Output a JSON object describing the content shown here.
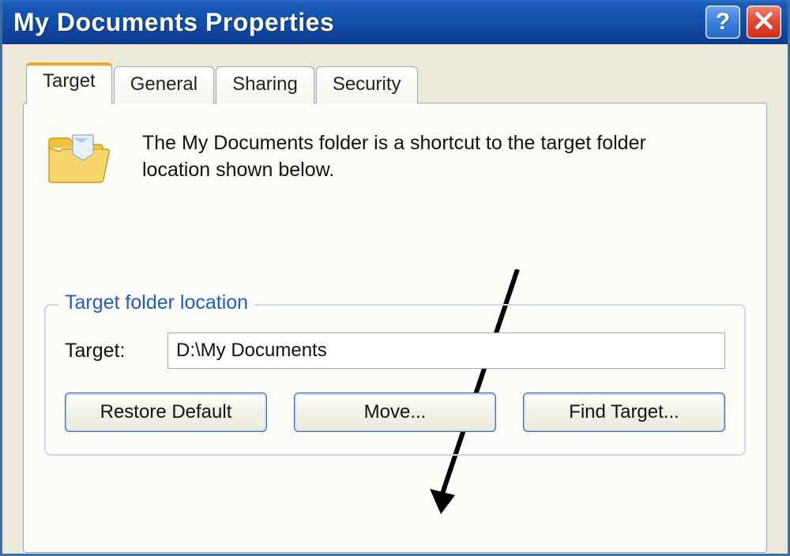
{
  "window": {
    "title": "My Documents Properties"
  },
  "tabs": [
    {
      "label": "Target",
      "active": true
    },
    {
      "label": "General",
      "active": false
    },
    {
      "label": "Sharing",
      "active": false
    },
    {
      "label": "Security",
      "active": false
    }
  ],
  "intro": {
    "text": "The My Documents folder is a shortcut to the target folder location shown below."
  },
  "group": {
    "legend": "Target folder location",
    "field_label": "Target:",
    "field_value": "D:\\My Documents"
  },
  "buttons": {
    "restore": "Restore Default",
    "move": "Move...",
    "find": "Find Target..."
  }
}
